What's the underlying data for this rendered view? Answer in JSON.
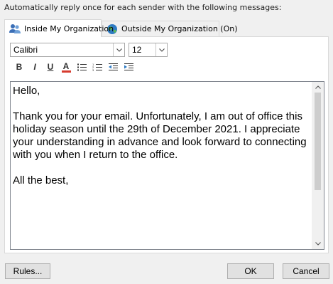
{
  "instruction": "Automatically reply once for each sender with the following messages:",
  "tabs": [
    {
      "label": "Inside My Organization",
      "icon": "people-icon",
      "active": true
    },
    {
      "label": "Outside My Organization (On)",
      "icon": "globe-icon",
      "active": false
    }
  ],
  "format": {
    "font": "Calibri",
    "size": "12",
    "buttons": {
      "bold": "B",
      "italic": "I",
      "underline": "U",
      "font_color": "A"
    }
  },
  "message": {
    "paragraphs": [
      "Hello,",
      "Thank you for your email. Unfortunately, I am out of office this holiday season until the 29th of December 2021. I appreciate your understanding in advance and look forward to connecting with you when I return to the office.",
      "All the best,"
    ]
  },
  "buttons": {
    "rules": "Rules...",
    "ok": "OK",
    "cancel": "Cancel"
  },
  "colors": {
    "accent": "#d63b2f",
    "globe": "#2e7bc4"
  }
}
